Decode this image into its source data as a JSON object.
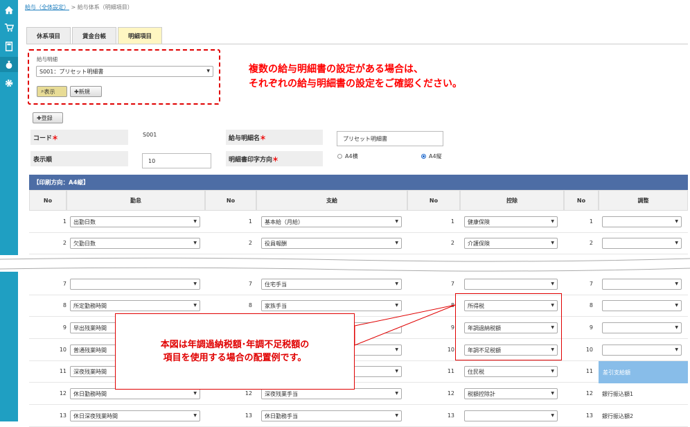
{
  "sidebar": {
    "icons": [
      "home-icon",
      "cart-icon",
      "calculator-icon",
      "money-bag-icon",
      "gear-icon"
    ]
  },
  "breadcrumb": {
    "link": "給与（全体設定）",
    "sep": ">",
    "current": "給与体系（明細項目）"
  },
  "tabs": [
    {
      "label": "休系項目"
    },
    {
      "label": "賃金台帳"
    },
    {
      "label": "明細項目"
    }
  ],
  "selector": {
    "label": "給与明細",
    "value": "S001：プリセット明細書",
    "show_label": "表示",
    "new_label": "新規"
  },
  "note_top": {
    "line1": "複数の給与明細書の設定がある場合は、",
    "line2": "それぞれの給与明細書の設定をご確認ください。"
  },
  "register_label": "登録",
  "form": {
    "code_label": "コード",
    "code_value": "S001",
    "name_label": "給与明細名",
    "name_value": "プリセット明細書",
    "order_label": "表示順",
    "order_value": "10",
    "print_label": "明細書印字方向",
    "required_mark": "＊",
    "radio_a4_landscape": "A4横",
    "radio_a4_portrait": "A4縦"
  },
  "table": {
    "title": "【印刷方向：A4縦】",
    "headers": [
      "No",
      "勤怠",
      "No",
      "支給",
      "No",
      "控除",
      "No",
      "調整"
    ],
    "rows_top": [
      {
        "no": "1",
        "kintai": "出勤日数",
        "shikyu": "基本給（月給）",
        "kojo": "健康保険",
        "chosei": ""
      },
      {
        "no": "2",
        "kintai": "欠勤日数",
        "shikyu": "役員報酬",
        "kojo": "介護保険",
        "chosei": ""
      }
    ],
    "rows_bottom": [
      {
        "no": "7",
        "kintai": "",
        "shikyu": "住宅手当",
        "kojo": "",
        "chosei": ""
      },
      {
        "no": "8",
        "kintai": "所定勤務時間",
        "shikyu": "家族手当",
        "kojo": "所得税",
        "chosei": ""
      },
      {
        "no": "9",
        "kintai": "早出残業時間",
        "shikyu": "",
        "kojo": "年調過納税額",
        "chosei": ""
      },
      {
        "no": "10",
        "kintai": "普通残業時間",
        "shikyu": "",
        "kojo": "年調不足税額",
        "chosei": ""
      },
      {
        "no": "11",
        "kintai": "深夜残業時間",
        "shikyu": "",
        "kojo": "住民税",
        "chosei": "差引支給額"
      },
      {
        "no": "12",
        "kintai": "休日勤務時間",
        "shikyu": "深夜残業手当",
        "kojo": "税額控除計",
        "chosei": "銀行振込額1"
      },
      {
        "no": "13",
        "kintai": "休日深夜残業時間",
        "shikyu": "休日勤務手当",
        "kojo": "",
        "chosei": "銀行振込額2"
      }
    ]
  },
  "note_bottom": {
    "line1": "本図は年調過納税額･年調不足税額の",
    "line2": "項目を使用する場合の配置例です。"
  },
  "colors": {
    "sidebar": "#1f9fc2",
    "table_title": "#4d6da5",
    "highlight": "#88bde9",
    "note": "#e00000"
  }
}
